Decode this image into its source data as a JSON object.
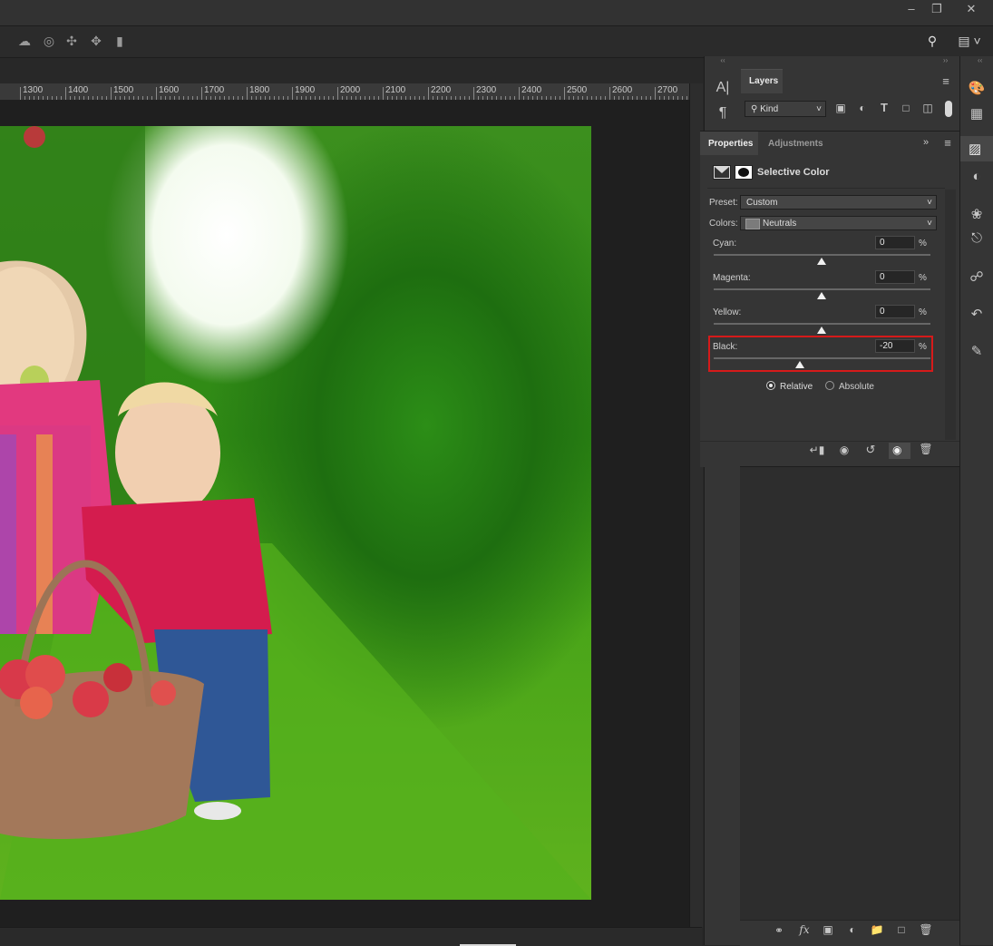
{
  "ruler": {
    "labels": [
      "1300",
      "1400",
      "1500",
      "1600",
      "1700",
      "1800",
      "1900",
      "2000",
      "2100",
      "2200",
      "2300",
      "2400",
      "2500",
      "2600",
      "2700"
    ]
  },
  "layers_panel": {
    "tab_label": "Layers",
    "filter_label": "Kind"
  },
  "properties_panel": {
    "tabs": [
      "Properties",
      "Adjustments"
    ],
    "title": "Selective Color",
    "preset_label": "Preset:",
    "preset_value": "Custom",
    "colors_label": "Colors:",
    "colors_value": "Neutrals",
    "percent_symbol": "%",
    "sliders": [
      {
        "label": "Cyan:",
        "value": "0"
      },
      {
        "label": "Magenta:",
        "value": "0"
      },
      {
        "label": "Yellow:",
        "value": "0"
      },
      {
        "label": "Black:",
        "value": "-20"
      }
    ],
    "method_options": [
      "Relative",
      "Absolute"
    ],
    "method_selected": "Relative"
  },
  "highlight_color": "#d61a1a",
  "icons": {
    "titlebar": [
      "minimize-icon",
      "restore-icon",
      "close-icon"
    ],
    "options_bar": [
      "3d-orbit-icon",
      "3d-roll-icon",
      "3d-pan-icon",
      "3d-slide-icon",
      "3d-camera-icon",
      "search-icon",
      "workspace-icon"
    ],
    "left_dock": [
      "character-icon",
      "paragraph-icon"
    ],
    "right_dock": [
      "color-palette-icon",
      "swatches-grid-icon",
      "3d-cube-icon",
      "adjustments-icon",
      "channels-icon",
      "paths-icon",
      "libraries-icon",
      "history-icon",
      "brush-settings-icon"
    ],
    "properties_footer": [
      "clip-to-layer-icon",
      "view-previous-icon",
      "reset-icon",
      "visibility-icon",
      "delete-icon"
    ],
    "layers_footer": [
      "link-layers-icon",
      "fx-icon",
      "add-mask-icon",
      "new-adjustment-icon",
      "new-group-icon",
      "new-layer-icon",
      "delete-layer-icon"
    ]
  }
}
